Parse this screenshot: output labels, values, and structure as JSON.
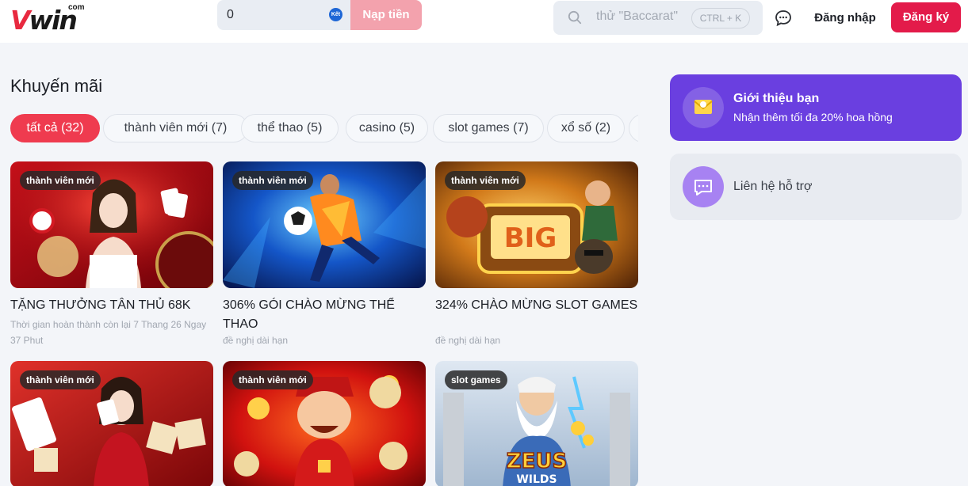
{
  "header": {
    "logo": {
      "main": "Vwin",
      "suffix": "com"
    },
    "balance": "0",
    "coin_icon_text": "Kết",
    "deposit_label": "Nạp tiền",
    "search_placeholder": "thử \"Baccarat\"",
    "search_shortcut": "CTRL + K",
    "login_label": "Đăng nhập",
    "register_label": "Đăng ký"
  },
  "main": {
    "title": "Khuyến mãi",
    "tabs": [
      {
        "label": "tất cả (32)",
        "active": true
      },
      {
        "label": "thành viên mới (7)"
      },
      {
        "label": "thể thao (5)"
      },
      {
        "label": "casino (5)"
      },
      {
        "label": "slot games (7)"
      },
      {
        "label": "xổ số (2)"
      },
      {
        "label": ""
      }
    ],
    "cards": [
      {
        "badge": "thành viên mới",
        "title": "TẶNG THƯỞNG TÂN THỦ 68K",
        "subtitle": "Thời gian hoàn thành còn lại 7 Thang 26 Ngay 37 Phut",
        "image": "casino-hostess-with-cards"
      },
      {
        "badge": "thành viên mới",
        "title": "306% GÓI CHÀO MỪNG THỂ THAO",
        "subtitle": "đề nghị dài hạn",
        "image": "soccer-player-kicking-ball"
      },
      {
        "badge": "thành viên mới",
        "title": "324% CHÀO MỪNG SLOT GAMES",
        "subtitle": "đề nghị dài hạn",
        "image": "big-win-slot-machine"
      },
      {
        "badge": "thành viên mới",
        "title": "",
        "subtitle": "",
        "image": "woman-with-playing-cards"
      },
      {
        "badge": "thành viên mới",
        "title": "",
        "subtitle": "",
        "image": "god-of-wealth-with-lottery-balls"
      },
      {
        "badge": "slot games",
        "title": "",
        "subtitle": "",
        "image": "mighty-zeus-wilds"
      }
    ]
  },
  "sidebar": {
    "refer": {
      "title": "Giới thiệu bạn",
      "subtitle": "Nhận thêm tối đa 20% hoa hồng"
    },
    "support": {
      "label": "Liên hệ hỗ trợ"
    }
  },
  "colors": {
    "brand_red": "#e31b4a",
    "active_tab": "#ef3b4f",
    "refer_purple": "#6a3fe0",
    "deposit_pink": "#f3a2ad"
  }
}
